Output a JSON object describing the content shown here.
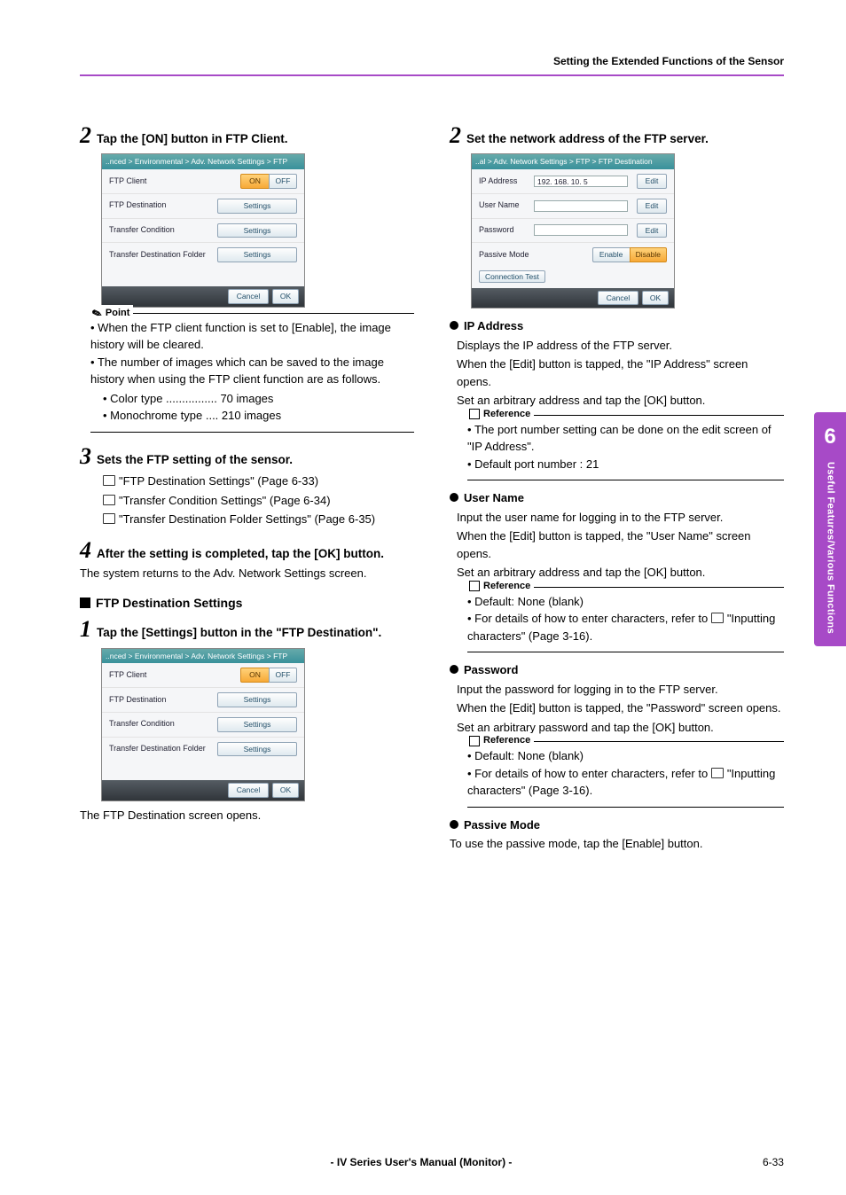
{
  "header": {
    "title": "Setting the Extended Functions of the Sensor"
  },
  "sidebar": {
    "chapter": "6",
    "label": "Useful Features/Various Functions"
  },
  "footer": {
    "manual": "- IV Series User's Manual (Monitor) -",
    "page": "6-33"
  },
  "left": {
    "step2": {
      "num": "2",
      "title": "Tap the [ON] button in FTP Client.",
      "ui": {
        "crumb": "..nced > Environmental > Adv. Network Settings > FTP",
        "rows": {
          "ftp_client": "FTP Client",
          "ftp_dest": "FTP Destination",
          "transfer_cond": "Transfer Condition",
          "transfer_folder": "Transfer Destination Folder"
        },
        "btn": {
          "on": "ON",
          "off": "OFF",
          "settings": "Settings",
          "cancel": "Cancel",
          "ok": "OK"
        }
      },
      "point_label": "Point",
      "point_items": [
        "When the FTP client function is set to [Enable], the image history will be cleared.",
        "The number of images which can be saved to the image history when using the FTP client function are as follows."
      ],
      "point_sub": {
        "color_label": "Color type",
        "color_value": "70 images",
        "mono_label": "Monochrome type",
        "mono_value": "210 images"
      }
    },
    "step3": {
      "num": "3",
      "title": "Sets the FTP setting of the sensor.",
      "refs": [
        "\"FTP Destination Settings\" (Page 6-33)",
        "\"Transfer Condition Settings\" (Page 6-34)",
        "\"Transfer Destination Folder Settings\" (Page 6-35)"
      ]
    },
    "step4": {
      "num": "4",
      "title": "After the setting is completed, tap the [OK] button.",
      "body": "The system returns to the Adv. Network Settings screen."
    },
    "section": {
      "heading": "FTP Destination Settings",
      "step1": {
        "num": "1",
        "title": "Tap the [Settings] button in the \"FTP Destination\".",
        "after": "The FTP Destination screen opens."
      }
    }
  },
  "right": {
    "step2": {
      "num": "2",
      "title": "Set the network address of the FTP server.",
      "ui": {
        "crumb": "..al > Adv. Network Settings > FTP > FTP Destination",
        "labels": {
          "ip": "IP Address",
          "user": "User Name",
          "pass": "Password",
          "passive": "Passive Mode"
        },
        "ip_value": "192. 168.  10.   5",
        "btn": {
          "edit": "Edit",
          "enable": "Enable",
          "disable": "Disable",
          "conntest": "Connection Test",
          "cancel": "Cancel",
          "ok": "OK"
        }
      }
    },
    "ip": {
      "h": "IP Address",
      "p1": "Displays the IP address of the FTP server.",
      "p2": "When the [Edit] button is tapped, the \"IP Address\" screen opens.",
      "p3": "Set an arbitrary address and tap the [OK] button.",
      "ref_label": "Reference",
      "ref_items": [
        "The port number setting can be done on the edit screen of \"IP Address\".",
        "Default port number : 21"
      ]
    },
    "user": {
      "h": "User Name",
      "p1": "Input the user name for logging in to the FTP server.",
      "p2": "When the [Edit] button is tapped, the \"User Name\" screen opens.",
      "p3": "Set an arbitrary address and tap the [OK] button.",
      "ref_label": "Reference",
      "ref_items": [
        "Default: None (blank)",
        "For details of how to enter characters, refer to"
      ],
      "ref_link": "\"Inputting characters\" (Page 3-16)."
    },
    "password": {
      "h": "Password",
      "p1": "Input the password for logging in to the FTP server.",
      "p2": "When the [Edit] button is tapped, the \"Password\" screen opens.",
      "p3": "Set an arbitrary password and tap the [OK] button.",
      "ref_label": "Reference",
      "ref_items": [
        "Default: None (blank)",
        "For details of how to enter characters, refer to"
      ],
      "ref_link": "\"Inputting characters\" (Page 3-16)."
    },
    "passive": {
      "h": "Passive Mode",
      "p1": "To use the passive mode, tap the [Enable] button."
    }
  }
}
